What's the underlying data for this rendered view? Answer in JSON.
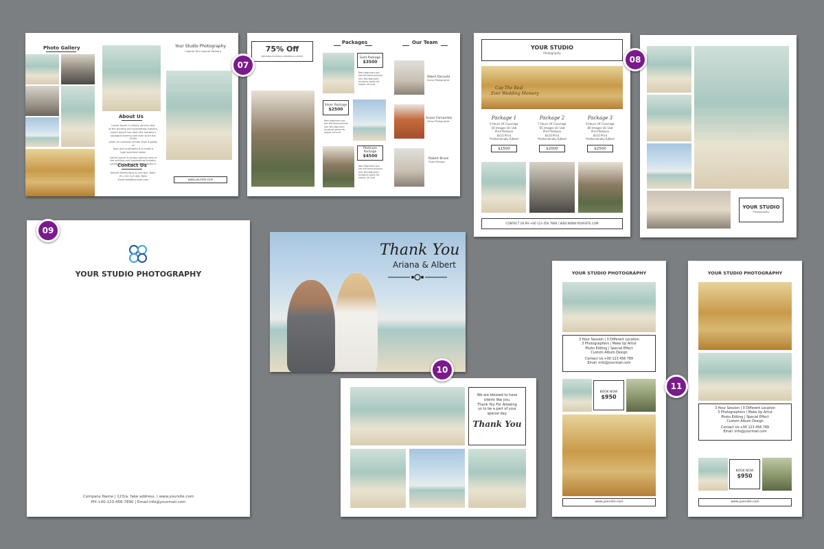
{
  "badges": {
    "b07": "07",
    "b08": "08",
    "b09": "09",
    "b10": "10",
    "b11": "11"
  },
  "brochure": {
    "gallery_title": "Photo Gallery",
    "about_title": "About Us",
    "about_text": [
      "Lorem Ipsum is simply dummy text",
      "of the printing and typesetting industry.",
      "Lorem Ipsum has been the industry's",
      "standard dummy text ever since the 1500s,",
      "when an unknown printer took a galley of",
      "type and scrambled it to make a",
      "type specimen book."
    ],
    "about_text2": [
      "Lorem Ipsum is simply dummy text of",
      "the printing and typesetting industry.",
      "Lorem Ipsum has been the industry's."
    ],
    "contact_title": "Contact Us",
    "contact_lines": [
      "Simple Street,Hous #-xxx,Your Town.",
      "Ph:+00 123 456 7890",
      "Email:info@yoursite.com"
    ],
    "cover_title": "Your Studio Photography",
    "cover_tagline": "Capture Your Special Moment",
    "cover_url": "www.yoursite.com",
    "offer": "75% Off",
    "offer_sub": "WEDDING,FASHION,COMMERCIAL,EVENT",
    "packages_title": "Packages",
    "team_title": "Our Team",
    "packages": [
      {
        "name": "Gold Package",
        "price": "$3500"
      },
      {
        "name": "Silver Package",
        "price": "$2500"
      },
      {
        "name": "Platinum Package",
        "price": "$4500"
      }
    ],
    "package_desc": [
      "Nam dignissim,non",
      "hon tincidunt pulvinar",
      "sed. Nisl dignissim",
      "turpissim porta nib",
      "neque, ed sunt"
    ],
    "team": [
      {
        "name": "Albert Decosta",
        "role": "Senior Photographer"
      },
      {
        "name": "Susan Farnandez",
        "role": "Senior Photographer"
      },
      {
        "name": "Robert Bruse",
        "role": "Photo Manager"
      }
    ]
  },
  "flyer08": {
    "title": "YOUR STUDIO",
    "subtitle": "Photography",
    "script_line1": "Cap The Best",
    "script_line2": "Ever Wedding Memory",
    "packages": [
      {
        "name": "Package 1",
        "lines": [
          "6 Hours Of Coverage",
          "50 Images On Usb",
          "Print Release",
          "8x10 Print",
          "Professionally Edited"
        ],
        "price": "$1500"
      },
      {
        "name": "Package 2",
        "lines": [
          "7 Hours Of Coverage",
          "65 Images On Usb",
          "Print Release",
          "8x10 Print",
          "Professionally Edited"
        ],
        "price": "$2000"
      },
      {
        "name": "Package 3",
        "lines": [
          "8 Hours Of Coverage",
          "80 Images On Usb",
          "Print Release",
          "8x10 Print",
          "Professionally Edited"
        ],
        "price": "$2500"
      }
    ],
    "contact": "CONTACT US:PH:+00 123 456 7890 | WEB:WWW.YOURSITE.COM"
  },
  "collage08": {
    "title": "YOUR STUDIO",
    "subtitle": "Photography"
  },
  "letterhead": {
    "title": "YOUR STUDIO PHOTOGRAPHY",
    "footer1": "Company Name | 123/a, fake address. | www.yoursite.com",
    "footer2": "PH:+00-123-456-7890 | Email:info@yourmail.com"
  },
  "thankyou": {
    "title": "Thank You",
    "names": "Ariana & Albert",
    "message": [
      "We are blessed to have",
      "clients like you.",
      "Thank You For Allowing",
      "us to be a part of your",
      "special day."
    ],
    "small_title": "Thank You"
  },
  "rack1": {
    "title": "YOUR STUDIO PHOTOGRAPHY",
    "info": [
      "3 Hour Session | 3 Different Location",
      "3 Photographers | Make Up Artist",
      "Photo Editing | Special Effect",
      "Custom Album Design"
    ],
    "contact": [
      "Contact Us:+00 123 456 789",
      "Email :info@yourmail.com"
    ],
    "book": "BOOK NOW",
    "price": "$950",
    "url": "www.yoursite.com"
  },
  "rack2": {
    "title": "YOUR STUDIO PHOTOGRAPHY",
    "info": [
      "3 Hour Session | 3 Different Location",
      "3 Photographers | Make Up Artist",
      "Photo Editing | Special Effect",
      "Custom Album Design"
    ],
    "contact": [
      "Contact Us:+00 123 456 789",
      "Email :info@yourmail.com"
    ],
    "book": "BOOK NOW",
    "price": "$950",
    "url": "www.yoursite.com"
  }
}
